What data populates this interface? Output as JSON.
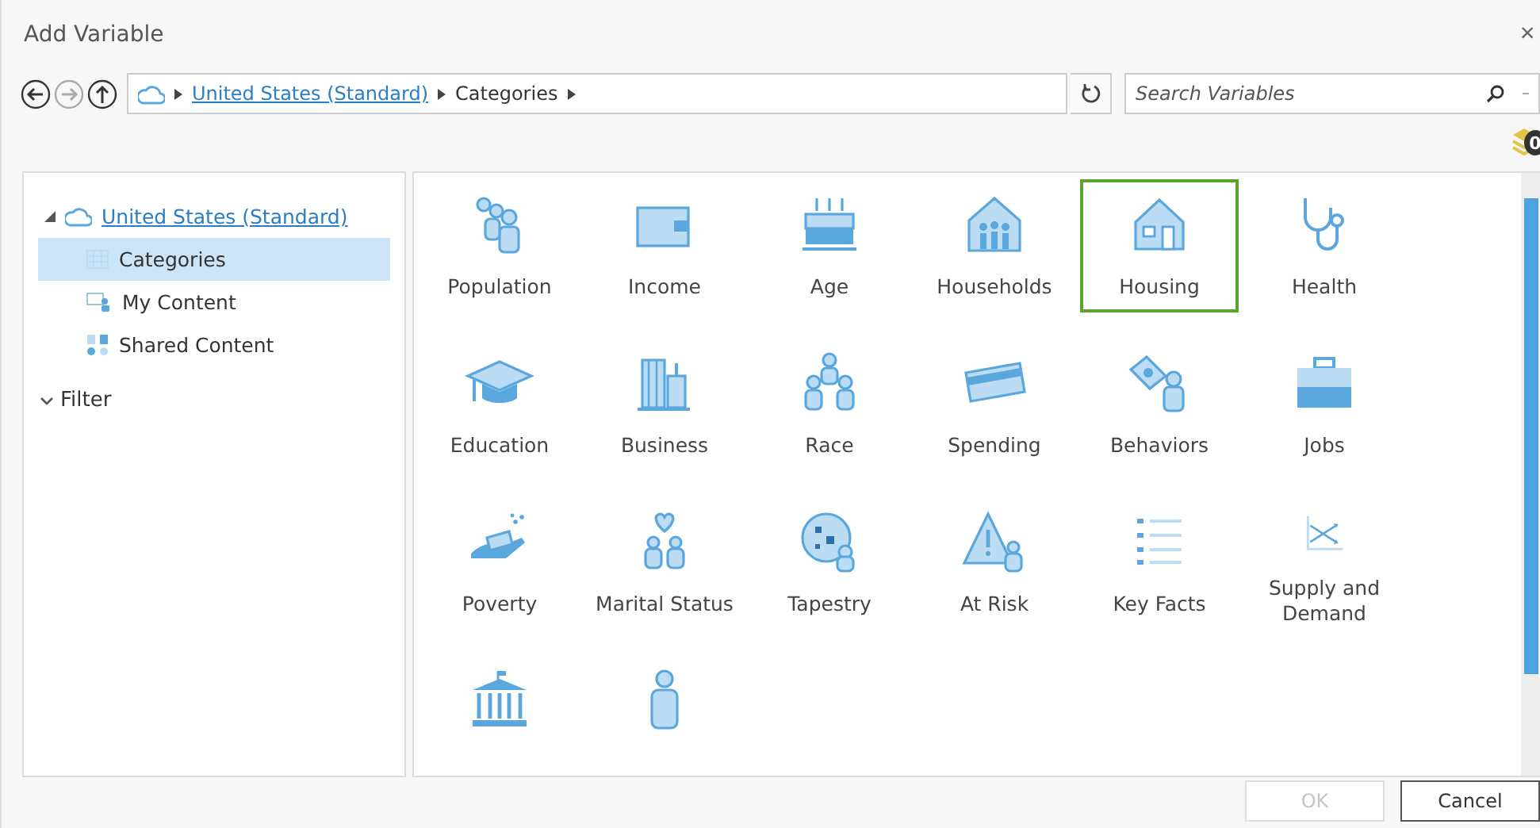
{
  "window": {
    "title": "Add Variable",
    "close": "×"
  },
  "nav": {
    "back_disabled": false,
    "forward_disabled": true,
    "up_disabled": false
  },
  "breadcrumb": [
    {
      "label": "United States (Standard)",
      "link": true
    },
    {
      "label": "Categories",
      "link": false
    }
  ],
  "search": {
    "placeholder": "Search Variables"
  },
  "selection_count": "0",
  "tree": [
    {
      "label": "United States (Standard)",
      "kind": "cloud",
      "link": true,
      "expanded": true,
      "selected": false,
      "children": [
        {
          "label": "Categories",
          "kind": "grid",
          "link": false,
          "selected": true
        },
        {
          "label": "My Content",
          "kind": "mycontent",
          "link": false,
          "selected": false
        },
        {
          "label": "Shared Content",
          "kind": "shared",
          "link": false,
          "selected": false
        }
      ]
    }
  ],
  "filter": {
    "label": "Filter"
  },
  "categories": [
    {
      "label": "Population",
      "kind": "people",
      "selected": false
    },
    {
      "label": "Income",
      "kind": "wallet",
      "selected": false
    },
    {
      "label": "Age",
      "kind": "cake",
      "selected": false
    },
    {
      "label": "Households",
      "kind": "household",
      "selected": false
    },
    {
      "label": "Housing",
      "kind": "house",
      "selected": true
    },
    {
      "label": "Health",
      "kind": "stethoscope",
      "selected": false
    },
    {
      "label": "Education",
      "kind": "cap",
      "selected": false
    },
    {
      "label": "Business",
      "kind": "buildings",
      "selected": false
    },
    {
      "label": "Race",
      "kind": "race",
      "selected": false
    },
    {
      "label": "Spending",
      "kind": "card",
      "selected": false
    },
    {
      "label": "Behaviors",
      "kind": "money",
      "selected": false
    },
    {
      "label": "Jobs",
      "kind": "briefcase",
      "selected": false
    },
    {
      "label": "Poverty",
      "kind": "hand",
      "selected": false
    },
    {
      "label": "Marital Status",
      "kind": "couple",
      "selected": false
    },
    {
      "label": "Tapestry",
      "kind": "tapestry",
      "selected": false
    },
    {
      "label": "At Risk",
      "kind": "warning",
      "selected": false
    },
    {
      "label": "Key Facts",
      "kind": "list",
      "selected": false
    },
    {
      "label": "Supply and Demand",
      "kind": "chart",
      "selected": false
    },
    {
      "kind": "government",
      "selected": false
    },
    {
      "kind": "person",
      "selected": false
    }
  ],
  "buttons": [
    {
      "label": "OK",
      "disabled": true
    },
    {
      "label": "Cancel",
      "disabled": false
    }
  ]
}
